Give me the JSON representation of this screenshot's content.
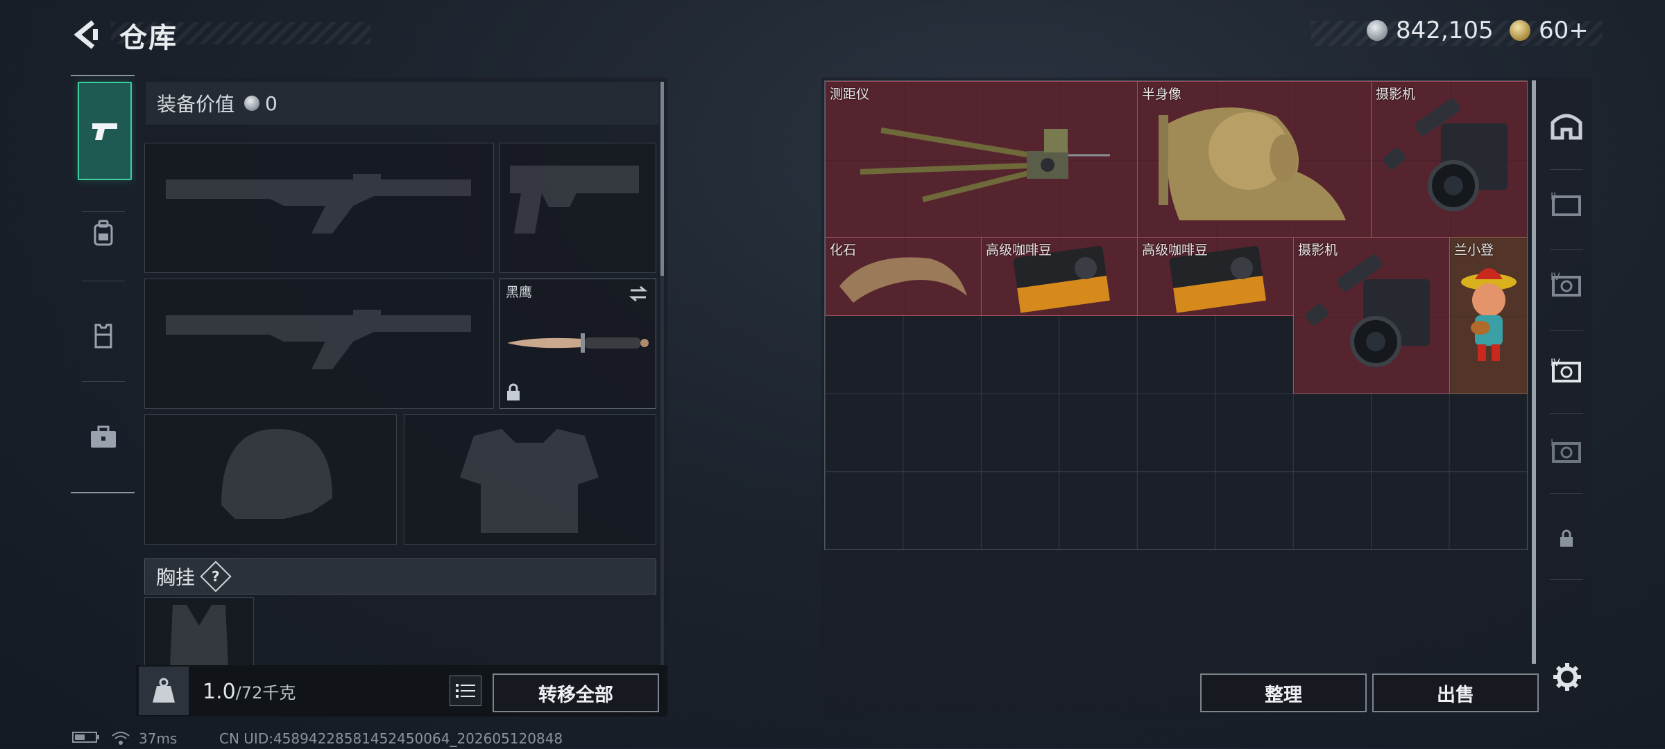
{
  "header": {
    "title": "仓库"
  },
  "currency": [
    {
      "icon": "silver-coin-icon",
      "value": "842,105"
    },
    {
      "icon": "gold-coin-icon",
      "value": "60+"
    }
  ],
  "left_rail": {
    "tabs": [
      {
        "icon": "pistol-icon",
        "active": true
      },
      {
        "icon": "backpack-icon",
        "active": false
      },
      {
        "icon": "vest-icon",
        "active": false
      },
      {
        "icon": "briefcase-icon",
        "active": false
      }
    ]
  },
  "equipment": {
    "value_label": "装备价值",
    "value": "0",
    "melee_label": "黑鹰",
    "chest_label": "胸挂",
    "help_symbol": "?"
  },
  "footer": {
    "weight": "1.0",
    "weight_capacity": "/72千克",
    "transfer_all": "转移全部",
    "sort": "整理",
    "sell": "出售"
  },
  "stash_items": [
    {
      "label": "测距仪"
    },
    {
      "label": "半身像"
    },
    {
      "label": "摄影机"
    },
    {
      "label": "化石"
    },
    {
      "label": "高级咖啡豆"
    },
    {
      "label": "高级咖啡豆"
    },
    {
      "label": "摄影机"
    },
    {
      "label": "兰小登"
    }
  ],
  "right_rail": {
    "tabs": [
      {
        "icon": "home-icon"
      },
      {
        "icon": "stash-page-2-icon"
      },
      {
        "icon": "stash-page-3-icon"
      },
      {
        "icon": "stash-page-4-icon"
      },
      {
        "icon": "stash-page-5-icon"
      },
      {
        "icon": "lock-icon"
      }
    ]
  },
  "status": {
    "ping": "37ms",
    "uid": "CN UID:4589422858145245006​4_202605120848"
  },
  "colors": {
    "accent": "#3bd19e",
    "item_bg": "#6e2630",
    "item_orange_bg": "#5f3a28"
  }
}
